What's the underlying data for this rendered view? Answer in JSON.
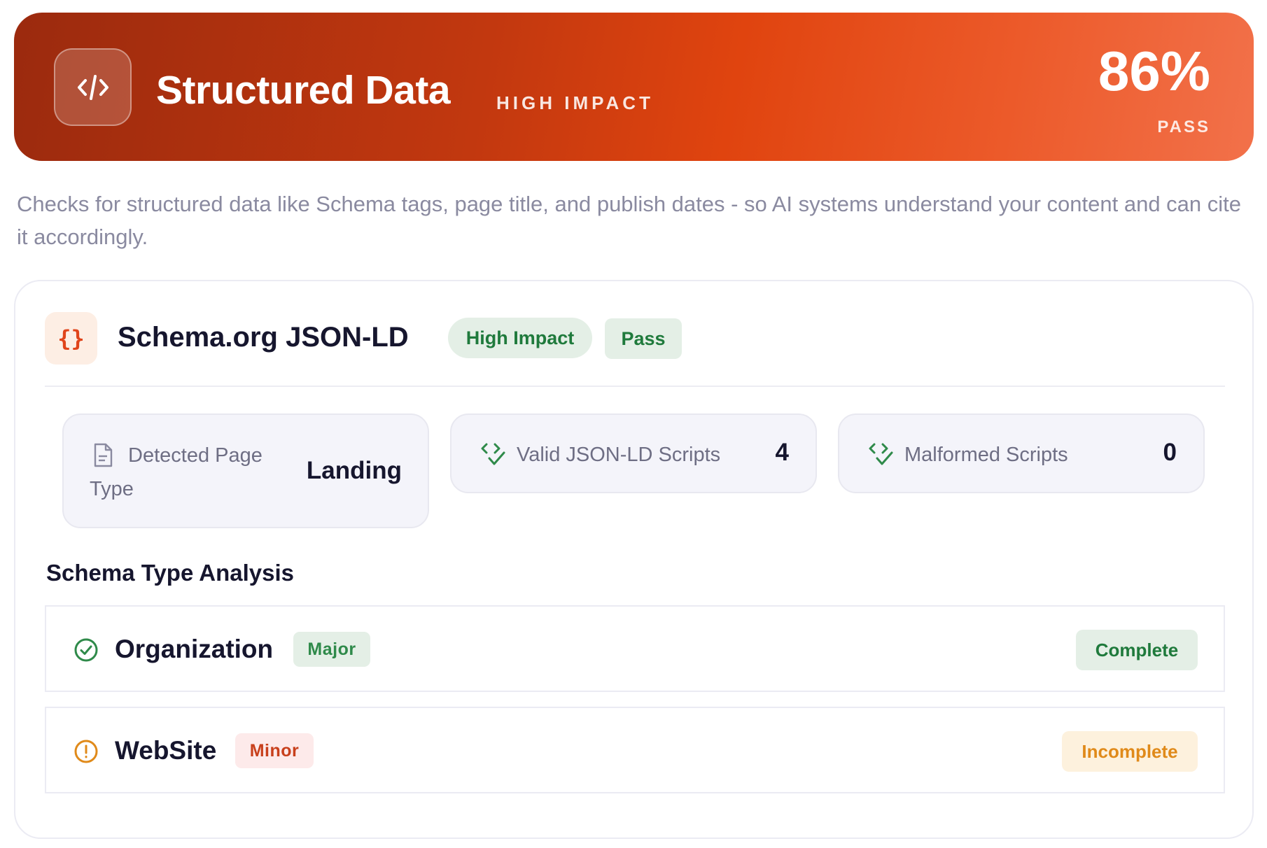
{
  "header": {
    "icon": "code-icon",
    "title": "Structured Data",
    "impact": "HIGH IMPACT",
    "score": "86%",
    "status": "PASS",
    "colors": {
      "gradient_start": "#9b2a0e",
      "gradient_mid": "#e0440f",
      "gradient_end": "#f2714a"
    }
  },
  "description": "Checks for structured data like Schema tags, page title, and publish dates - so AI systems understand your content and can cite it accordingly.",
  "schema_card": {
    "icon": "braces-icon",
    "icon_glyph": "{}",
    "title": "Schema.org JSON-LD",
    "impact_badge": "High Impact",
    "status_badge": "Pass",
    "stats": [
      {
        "icon": "document-icon",
        "label_line1": "Detected Page",
        "label_line2": "Type",
        "value": "Landing"
      },
      {
        "icon": "code-check-icon",
        "label": "Valid JSON-LD Scripts",
        "value": "4"
      },
      {
        "icon": "code-check-icon",
        "label": "Malformed Scripts",
        "value": "0"
      }
    ],
    "analysis": {
      "title": "Schema Type Analysis",
      "items": [
        {
          "icon": "check-circle-icon",
          "name": "Organization",
          "severity": "Major",
          "status": "Complete"
        },
        {
          "icon": "alert-circle-icon",
          "name": "WebSite",
          "severity": "Minor",
          "status": "Incomplete"
        }
      ]
    },
    "colors": {
      "success": "#1f7a3c",
      "warning": "#e08a1a",
      "accent": "#e0441a"
    }
  }
}
